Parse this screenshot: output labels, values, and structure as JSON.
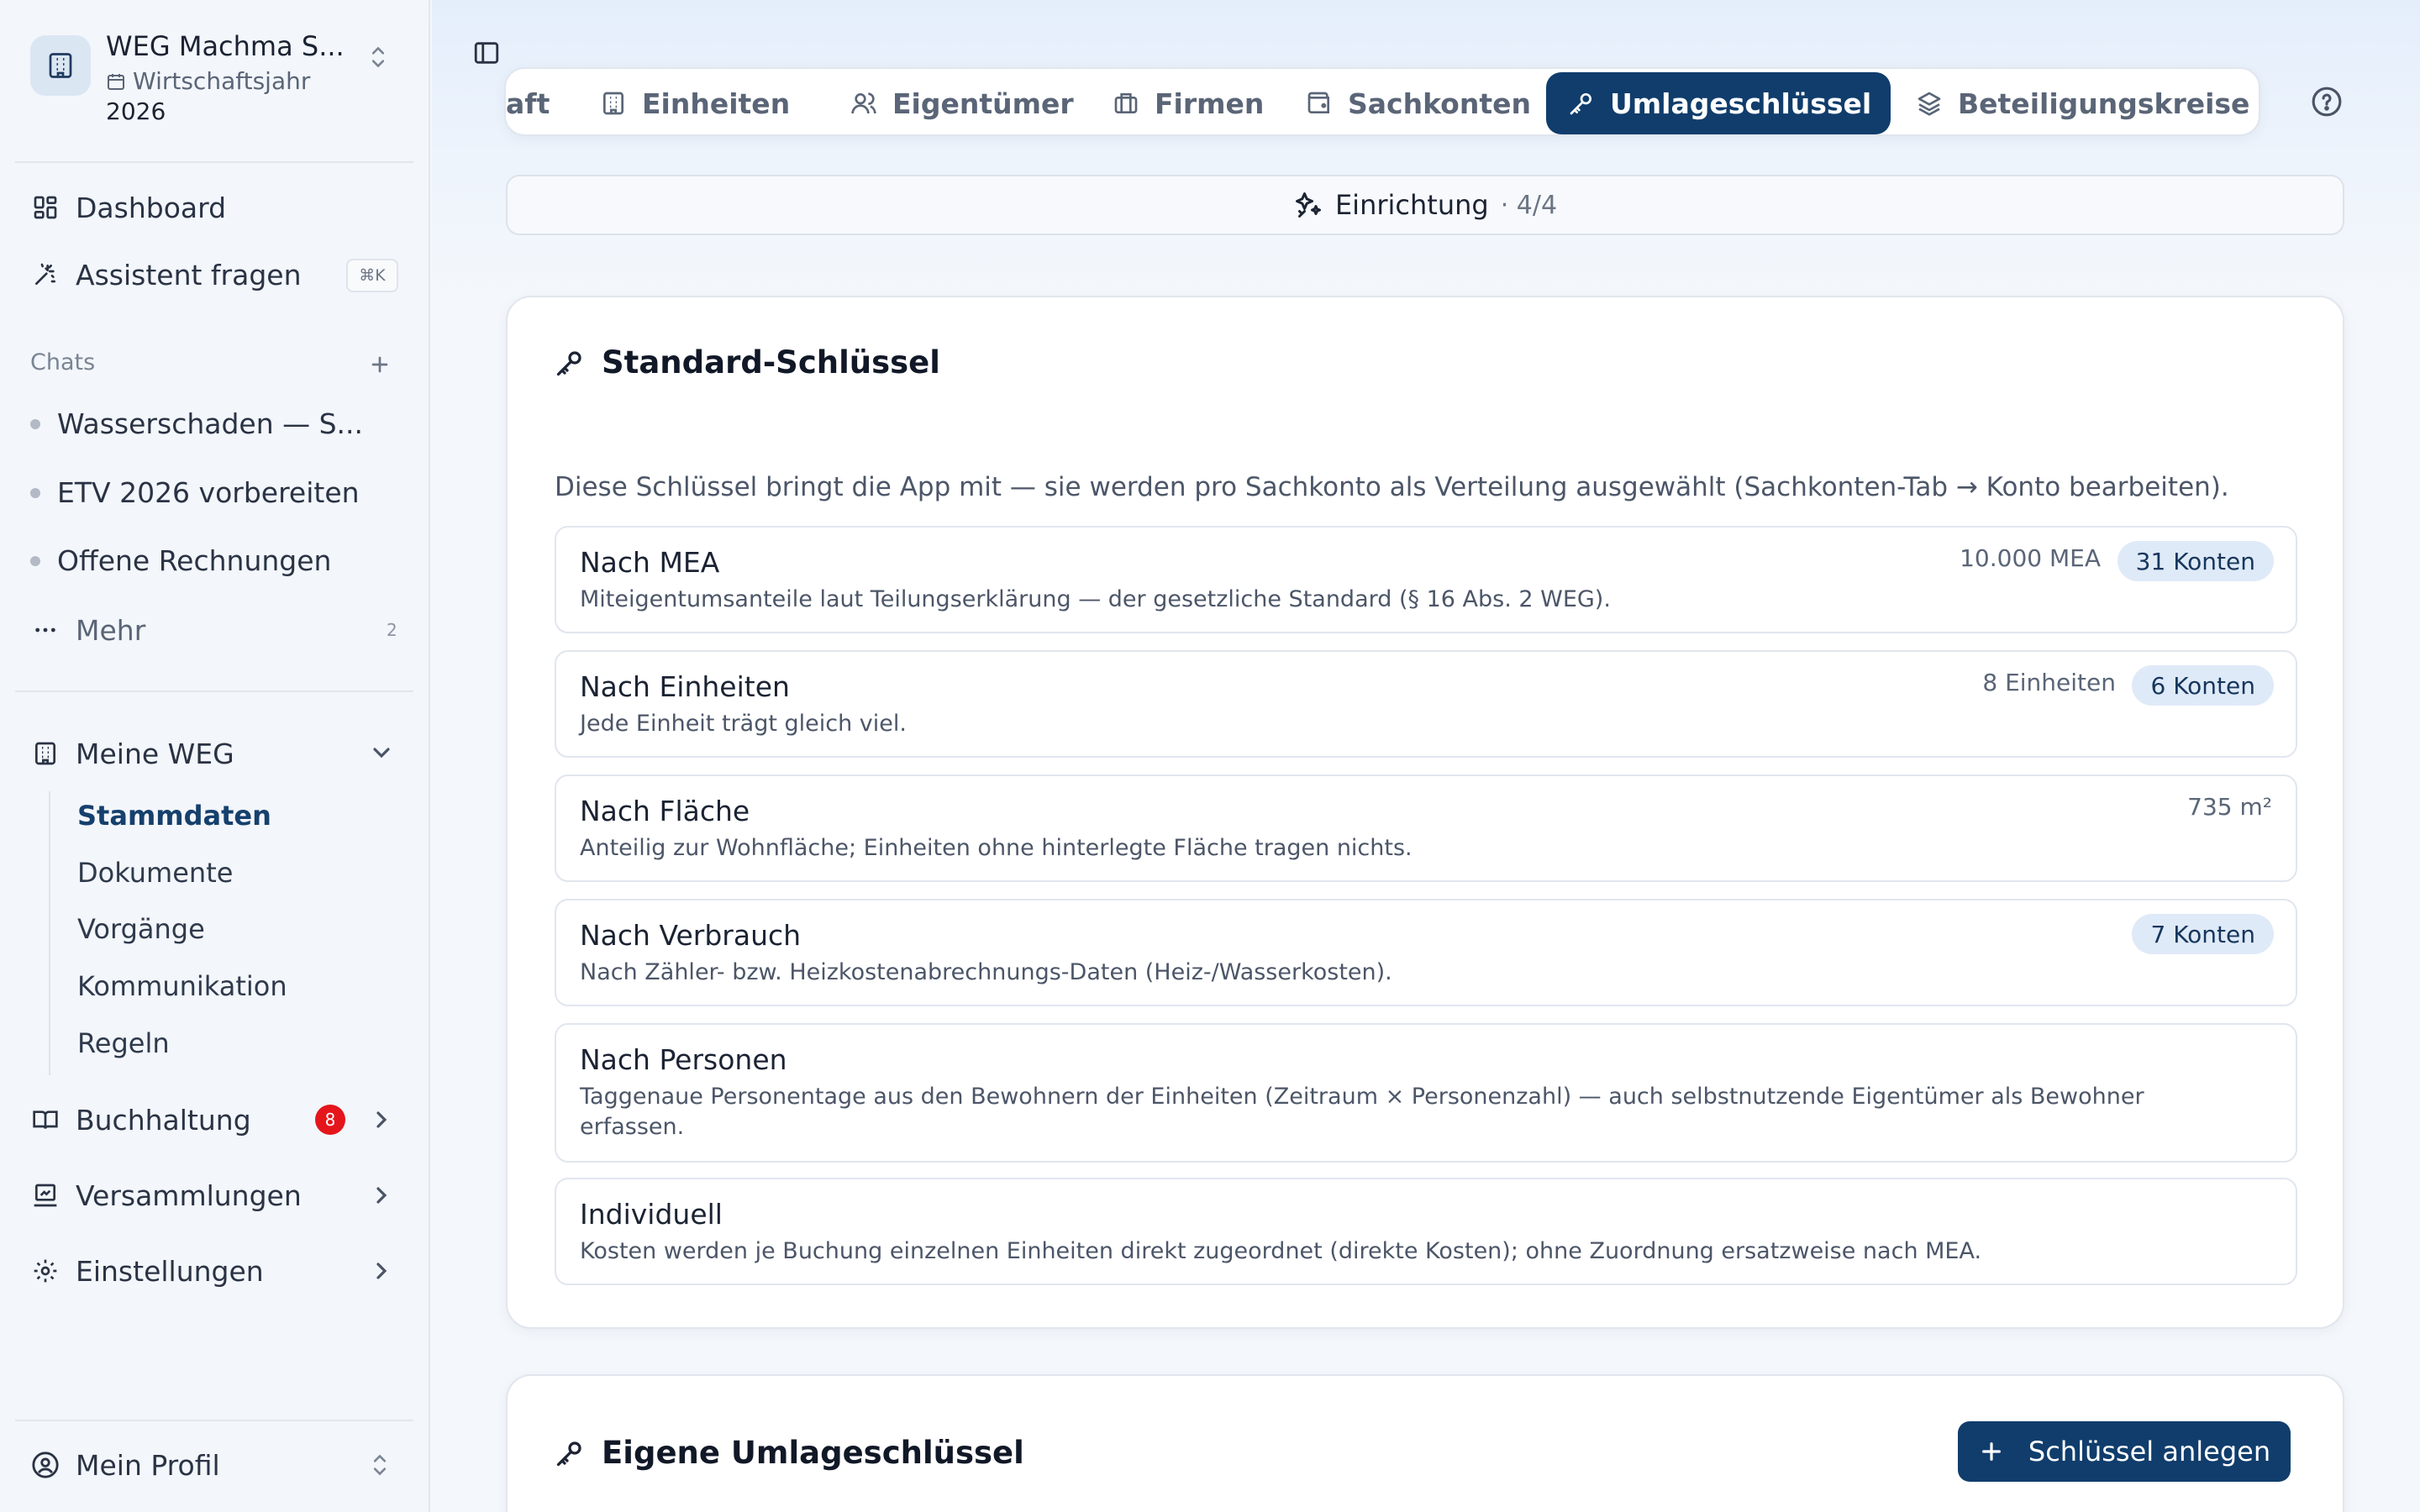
{
  "workspace": {
    "name": "WEG Machma S...",
    "fiscal_label": "Wirtschaftsjahr",
    "fiscal_year": "2026"
  },
  "nav": {
    "dashboard": "Dashboard",
    "assistant": "Assistent fragen",
    "assistant_shortcut": "⌘K"
  },
  "chats": {
    "label": "Chats",
    "items": [
      "Wasserschaden — S...",
      "ETV 2026 vorbereiten",
      "Offene Rechnungen"
    ],
    "more_label": "Mehr",
    "more_count": "2"
  },
  "groups": {
    "meine_weg": {
      "label": "Meine WEG",
      "children": [
        "Stammdaten",
        "Dokumente",
        "Vorgänge",
        "Kommunikation",
        "Regeln"
      ],
      "active": "Stammdaten"
    },
    "buchhaltung": {
      "label": "Buchhaltung",
      "badge": "8"
    },
    "versammlungen": {
      "label": "Versammlungen"
    },
    "einstellungen": {
      "label": "Einstellungen"
    }
  },
  "profile": {
    "label": "Mein Profil"
  },
  "tabs": [
    {
      "label": "aft",
      "icon": "none"
    },
    {
      "label": "Einheiten",
      "icon": "building-icon"
    },
    {
      "label": "Eigentümer",
      "icon": "users-icon"
    },
    {
      "label": "Firmen",
      "icon": "briefcase-icon"
    },
    {
      "label": "Sachkonten",
      "icon": "wallet-icon"
    },
    {
      "label": "Umlageschlüssel",
      "icon": "key-icon",
      "active": true
    },
    {
      "label": "Beteiligungskreise",
      "icon": "layers-icon"
    }
  ],
  "setup": {
    "label": "Einrichtung",
    "step": "· 4/4"
  },
  "standard_keys": {
    "title": "Standard-Schlüssel",
    "description": "Diese Schlüssel bringt die App mit — sie werden pro Sachkonto als Verteilung ausgewählt (Sachkonten-Tab → Konto bearbeiten).",
    "items": [
      {
        "name": "Nach MEA",
        "desc": "Miteigentumsanteile laut Teilungserklärung — der gesetzliche Standard (§ 16 Abs. 2 WEG).",
        "meta": "10.000 MEA",
        "pill": "31 Konten"
      },
      {
        "name": "Nach Einheiten",
        "desc": "Jede Einheit trägt gleich viel.",
        "meta": "8 Einheiten",
        "pill": "6 Konten"
      },
      {
        "name": "Nach Fläche",
        "desc": "Anteilig zur Wohnfläche; Einheiten ohne hinterlegte Fläche tragen nichts.",
        "meta": "735 m²",
        "pill": ""
      },
      {
        "name": "Nach Verbrauch",
        "desc": "Nach Zähler- bzw. Heizkostenabrechnungs-Daten (Heiz-/Wasserkosten).",
        "meta": "",
        "pill": "7 Konten"
      },
      {
        "name": "Nach Personen",
        "desc": "Taggenaue Personentage aus den Bewohnern der Einheiten (Zeitraum × Personenzahl) — auch selbstnutzende Eigentümer als Bewohner erfassen.",
        "meta": "",
        "pill": ""
      },
      {
        "name": "Individuell",
        "desc": "Kosten werden je Buchung einzelnen Einheiten direkt zugeordnet (direkte Kosten); ohne Zuordnung ersatzweise nach MEA.",
        "meta": "",
        "pill": ""
      }
    ]
  },
  "custom_keys": {
    "title": "Eigene Umlageschlüssel",
    "add_label": "Schlüssel anlegen"
  },
  "colors": {
    "primary": "#103d6c",
    "badge": "#e5151c",
    "pill_bg": "#dfeaf8",
    "sidebar_bg": "#f3f6fa"
  }
}
